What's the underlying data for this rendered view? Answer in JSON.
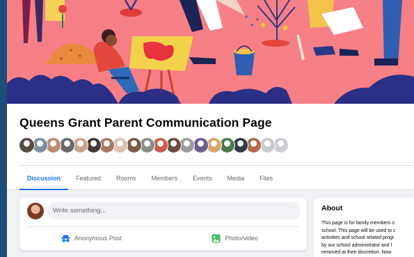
{
  "group": {
    "title": "Queens Grant Parent Communication Page"
  },
  "members_preview": {
    "avatar_colors": [
      "#5b4a44",
      "#7d8fa3",
      "#b98b6f",
      "#6a6a6a",
      "#c9a48a",
      "#3e3a3a",
      "#a97863",
      "#d9c2b3",
      "#7e5a4a",
      "#8c8c8c",
      "#c45d4c",
      "#6a4d43",
      "#9a9a9a",
      "#6b5b8f",
      "#d8a86a",
      "#4a7a53",
      "#2f3b46",
      "#b5694f",
      "#c8ccd0",
      "#c8ccd0"
    ]
  },
  "tabs": [
    {
      "label": "Discussion",
      "active": true
    },
    {
      "label": "Featured",
      "active": false
    },
    {
      "label": "Rooms",
      "active": false
    },
    {
      "label": "Members",
      "active": false
    },
    {
      "label": "Events",
      "active": false
    },
    {
      "label": "Media",
      "active": false
    },
    {
      "label": "Files",
      "active": false
    }
  ],
  "composer": {
    "placeholder": "Write something...",
    "anonymous_label": "Anonymous Post",
    "photo_label": "Photo/video",
    "anonymous_icon_color": "#1b74e4",
    "photo_icon_color": "#45bd62"
  },
  "about": {
    "title": "About",
    "lines": [
      "This page is for family members o",
      "school. This page will be used to c",
      "activities and school related progr",
      "by our school administrator and l",
      "removed at their discretion. Now"
    ]
  },
  "colors": {
    "accent": "#1b74e4",
    "cover_bg": "#f77f86",
    "cover_dark": "#2c2f86"
  }
}
